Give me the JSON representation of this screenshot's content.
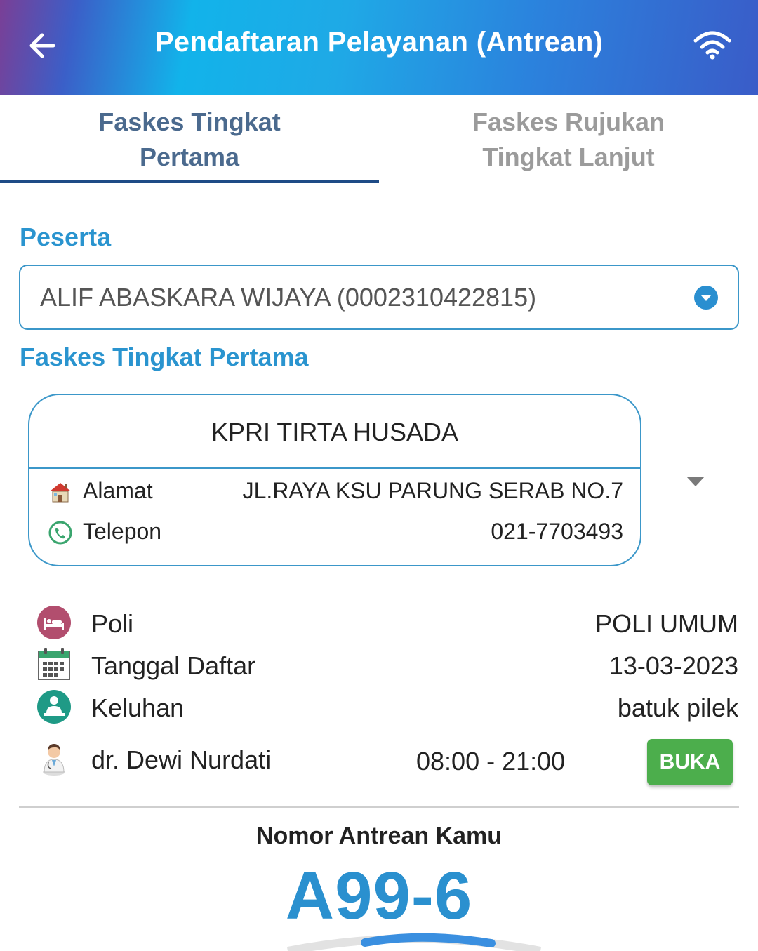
{
  "header": {
    "title": "Pendaftaran Pelayanan (Antrean)"
  },
  "tabs": [
    {
      "label_line1": "Faskes Tingkat",
      "label_line2": "Pertama"
    },
    {
      "label_line1": "Faskes Rujukan",
      "label_line2": "Tingkat Lanjut"
    }
  ],
  "peserta": {
    "label": "Peserta",
    "selected": "ALIF ABASKARA WIJAYA (0002310422815)"
  },
  "faskes": {
    "section_label": "Faskes Tingkat Pertama",
    "name": "KPRI TIRTA HUSADA",
    "alamat_label": "Alamat",
    "alamat_value": "JL.RAYA KSU PARUNG SERAB NO.7",
    "telepon_label": "Telepon",
    "telepon_value": "021-7703493"
  },
  "details": {
    "poli_label": "Poli",
    "poli_value": "POLI UMUM",
    "tanggal_label": "Tanggal Daftar",
    "tanggal_value": "13-03-2023",
    "keluhan_label": "Keluhan",
    "keluhan_value": "batuk pilek",
    "doctor_name": "dr. Dewi Nurdati",
    "doctor_hours": "08:00 - 21:00",
    "doctor_status": "BUKA"
  },
  "queue": {
    "label": "Nomor Antrean Kamu",
    "number": "A99-6"
  },
  "colors": {
    "accent": "#2a94cf",
    "tab_active": "#1e4b86",
    "status_open": "#4cae4c"
  },
  "icons": {
    "back": "arrow-left-icon",
    "wifi": "wifi-icon",
    "dropdown": "chevron-down-icon",
    "alamat": "house-icon",
    "telepon": "phone-icon",
    "poli": "hospital-bed-icon",
    "tanggal": "calendar-icon",
    "keluhan": "patient-icon",
    "doctor": "doctor-icon"
  }
}
